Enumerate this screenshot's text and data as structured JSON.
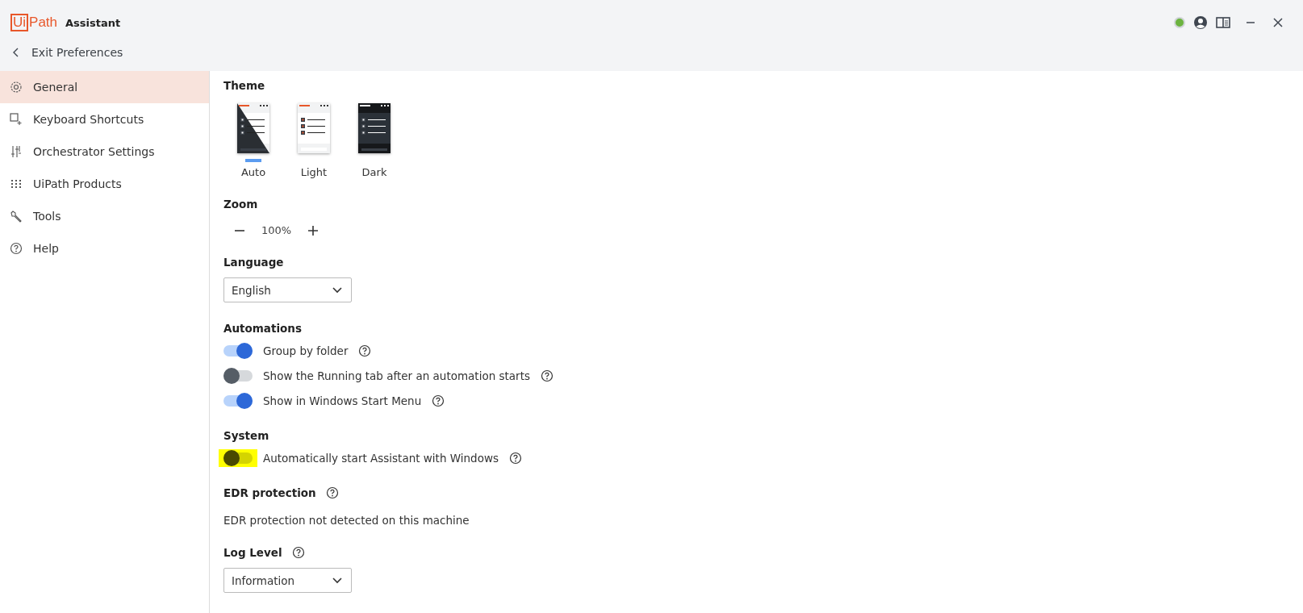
{
  "window": {
    "logo_boxed": "Ui",
    "logo_text": "Path",
    "title": "Assistant",
    "status_online": true
  },
  "back_link": "Exit Preferences",
  "sidebar": {
    "items": [
      {
        "label": "General",
        "kind": "gear",
        "selected": true
      },
      {
        "label": "Keyboard Shortcuts",
        "kind": "keyboard",
        "selected": false
      },
      {
        "label": "Orchestrator Settings",
        "kind": "sliders",
        "selected": false
      },
      {
        "label": "UiPath Products",
        "kind": "grid",
        "selected": false
      },
      {
        "label": "Tools",
        "kind": "wrench",
        "selected": false
      },
      {
        "label": "Help",
        "kind": "help",
        "selected": false
      }
    ]
  },
  "theme": {
    "heading": "Theme",
    "options": [
      {
        "label": "Auto",
        "kind": "auto",
        "selected": true
      },
      {
        "label": "Light",
        "kind": "light",
        "selected": false
      },
      {
        "label": "Dark",
        "kind": "dark",
        "selected": false
      }
    ]
  },
  "zoom": {
    "heading": "Zoom",
    "value": "100%"
  },
  "language": {
    "heading": "Language",
    "value": "English"
  },
  "automations": {
    "heading": "Automations",
    "toggles": [
      {
        "label": "Group by folder",
        "on": true,
        "highlighted": false
      },
      {
        "label": "Show the Running tab after an automation starts",
        "on": false,
        "highlighted": false
      },
      {
        "label": "Show in Windows Start Menu",
        "on": true,
        "highlighted": false
      }
    ]
  },
  "system": {
    "heading": "System",
    "toggles": [
      {
        "label": "Automatically start Assistant with Windows",
        "on": false,
        "highlighted": true
      }
    ]
  },
  "edr": {
    "heading": "EDR protection",
    "text": "EDR protection not detected on this machine"
  },
  "log_level": {
    "heading": "Log Level",
    "value": "Information"
  }
}
